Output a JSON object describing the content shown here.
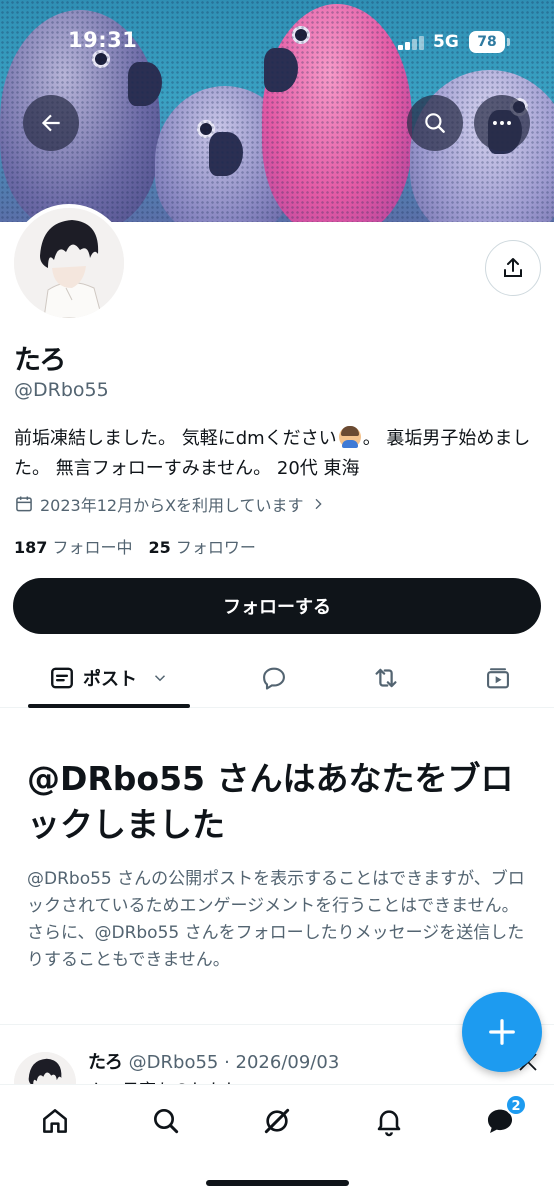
{
  "status_bar": {
    "time": "19:31",
    "network": "5G",
    "battery": "78"
  },
  "profile": {
    "name": "たろ",
    "handle": "@DRbo55",
    "bio_part1": "前垢凍結しました。 気軽にdmください",
    "bio_part2": "。 裏垢男子始めました。 無言フォローすみません。 20代 東海",
    "joined": "2023年12月からXを利用しています",
    "following_count": "187",
    "following_label": "フォロー中",
    "followers_count": "25",
    "followers_label": "フォロワー",
    "follow_button": "フォローする"
  },
  "tabs": {
    "posts_label": "ポスト"
  },
  "blocked": {
    "title": "@DRbo55 さんはあなたをブロックしました",
    "description": "@DRbo55 さんの公開ポストを表示することはできますが、ブロックされているためエンゲージメントを行うことはできません。さらに、@DRbo55 さんをフォローしたりメッセージを送信したりすることもできません。"
  },
  "tweet_preview": {
    "name": "たろ",
    "handle_date": "@DRbo55 · 2026/09/03",
    "text": "ん、日率ちのしかし、"
  },
  "nav": {
    "messages_badge": "2"
  },
  "colors": {
    "accent": "#1d9bf0",
    "text": "#0f1419",
    "secondary": "#536471"
  }
}
